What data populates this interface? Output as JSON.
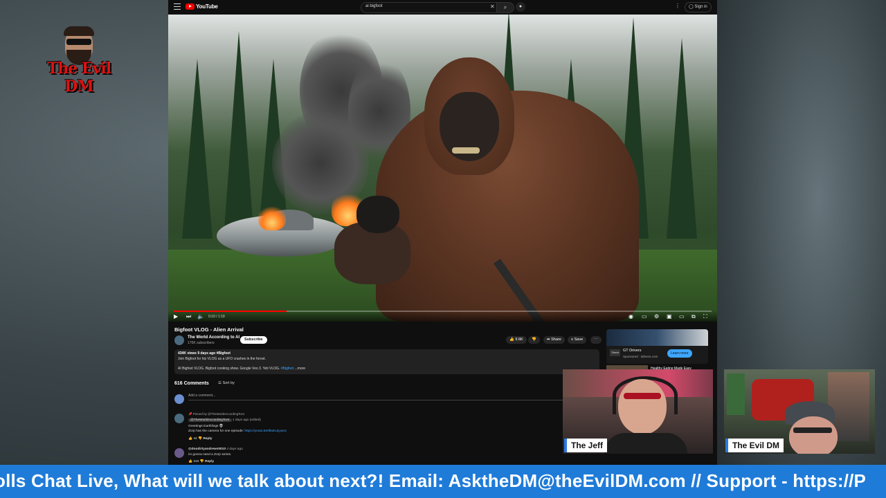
{
  "logo": {
    "text": "The Evil DM"
  },
  "browser": {
    "site_name": "YouTube",
    "search_value": "ai bigfoot",
    "sign_in_label": "Sign in"
  },
  "player": {
    "time_label": "0:10 / 1:19",
    "progress_fraction": 0.21
  },
  "video": {
    "title": "Bigfoot VLOG - Alien Arrival",
    "channel_name": "The World According to AI",
    "channel_subs": "176K subscribers",
    "subscribe_label": "Subscribe",
    "like_count": "9.6K",
    "share_label": "Share",
    "save_label": "Save",
    "description": {
      "meta": "434K views  9 days ago  #Bigfoot",
      "line1": "Join Bigfoot for his VLOG as a UFO crashes in the forest.",
      "line2_prefix": "AI Bigfoot VLOG. Bigfoot cooking show.  Google Veo 3. Yeti VLOG. ",
      "line2_tag": "#Bigfoot",
      "more_label": "...more"
    }
  },
  "comments": {
    "count_label": "616 Comments",
    "sort_label": "Sort by",
    "add_placeholder": "Add a comment...",
    "items": [
      {
        "pinned_label": "Pinned by @TheWorldAccordingToAI",
        "author": "@TheWorldAccordingToAI",
        "time": "1 days ago (edited)",
        "text": "Greetings Earthlings 👽",
        "text2_prefix": "Zorp has the camera for one episode: ",
        "link": "https://youtu.be/6bxlvJyywxc",
        "likes": "44",
        "reply_label": "Reply"
      },
      {
        "author": "@doodirtyandrews0010",
        "time": "4 days ago",
        "text": "im gonna need a Zorp series.",
        "likes": "316",
        "reply_label": "Reply"
      }
    ]
  },
  "sidebar": {
    "ad_title": "GT Drivers",
    "ad_sponsored": "Sponsored · tdrivers.com",
    "ad_learn_more": "Learn more",
    "ad_logo": "Titleist",
    "related_title": "Healthy Eating Made Easy"
  },
  "cams": {
    "left_name": "The Jeff",
    "right_name": "The Evil DM"
  },
  "ticker": {
    "text": "olls Chat Live, What will we talk about next?! Email: AsktheDM@theEvilDM.com // Support - https://P"
  },
  "colors": {
    "ticker_bg": "#1f7bd8",
    "yt_red": "#ff0000",
    "link_blue": "#3ea6ff"
  }
}
